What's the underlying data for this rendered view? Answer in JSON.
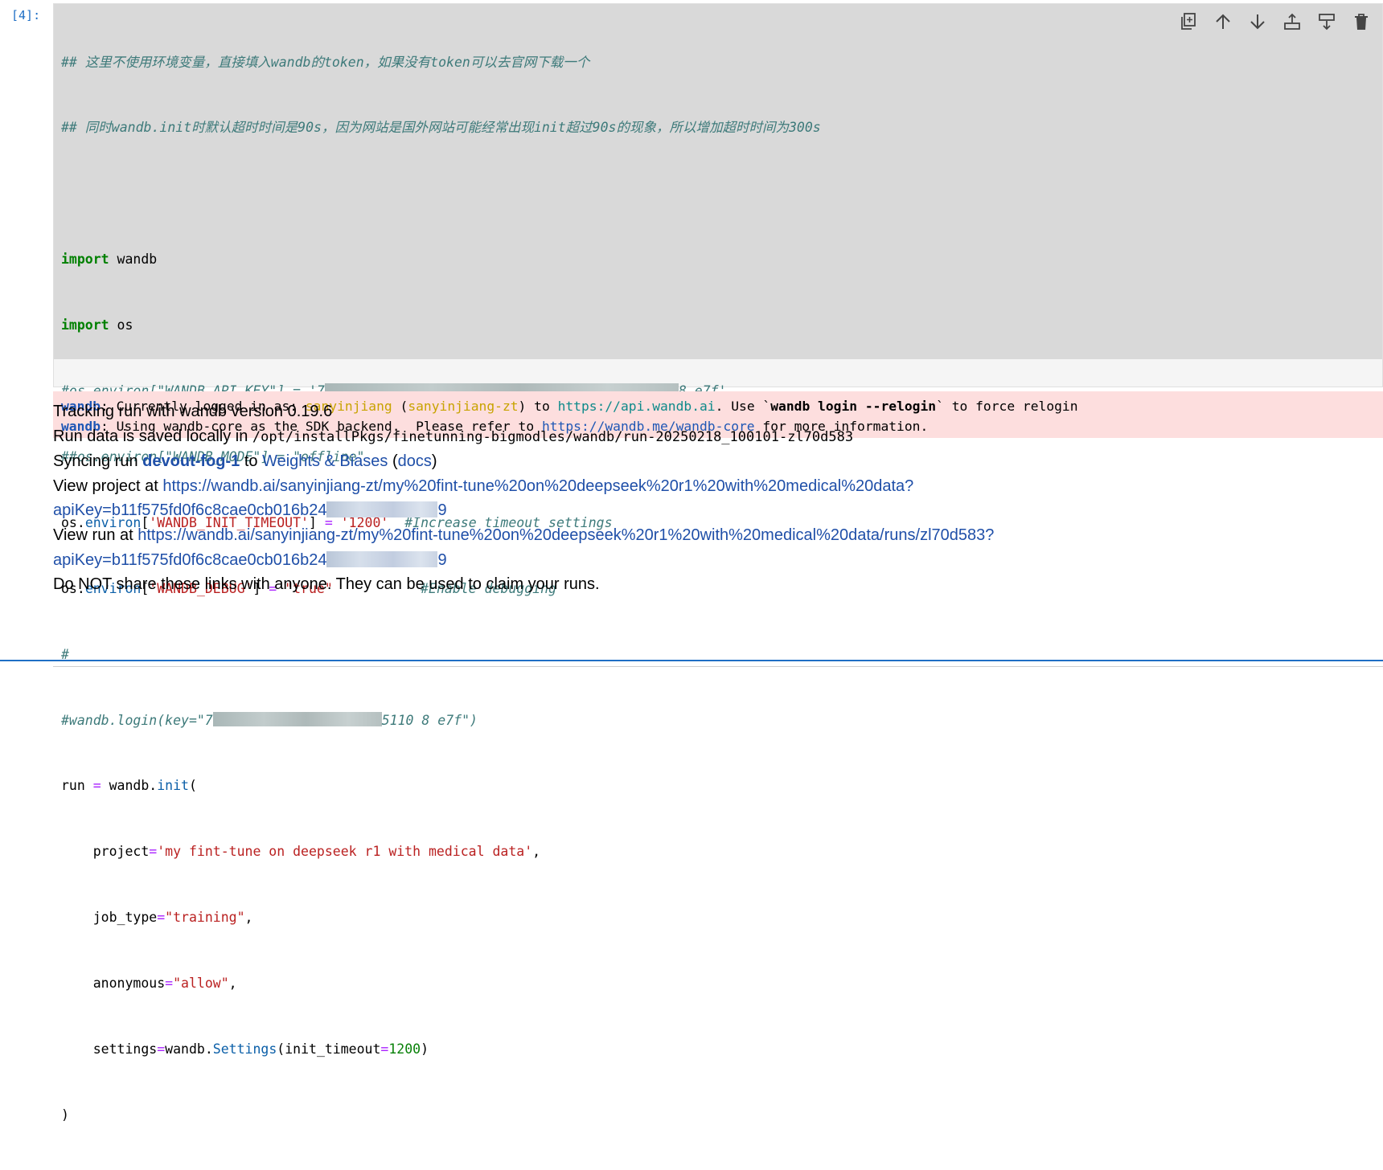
{
  "cell": {
    "prompt": "[4]:",
    "code": {
      "c1": "## 这里不使用环境变量，直接填入wandb的token，如果没有token可以去官网下载一个",
      "c2": "## 同时wandb.init时默认超时时间是90s，因为网站是国外网站可能经常出现init超过90s的现象，所以增加超时时间为300s",
      "import": "import",
      "wandb": "wandb",
      "os": "os",
      "api_key_prefix": "#os.environ[\"WANDB_API_KEY\"] = '7",
      "api_key_suffix": "8 e7f'",
      "mode_line": "##os.environ[\"WANDB_MODE\"] = \"offline\"",
      "os_obj": "os",
      "dot": ".",
      "environ": "environ",
      "lbr": "[",
      "rbr": "]",
      "init_timeout_key": "'WANDB_INIT_TIMEOUT'",
      "eq": " = ",
      "init_timeout_val": "'1200'",
      "timeout_comment": "#Increase timeout settings",
      "debug_key": "'WANDB_DEBUG'",
      "debug_val": "\"true\"",
      "debug_comment": "#Enable debugging",
      "hash": "#",
      "login_prefix": "#wandb.login(key=\"7",
      "login_suffix": "5110 8 e7f\")",
      "run": "run",
      "wandb2": "wandb",
      "init": "init",
      "paren_open": "(",
      "project_kw": "project",
      "project_val": "'my fint-tune on deepseek r1 with medical data'",
      "jobtype_kw": "job_type",
      "jobtype_val": "\"training\"",
      "anon_kw": "anonymous",
      "anon_val": "\"allow\"",
      "settings_kw": "settings",
      "wandb3": "wandb",
      "Settings": "Settings",
      "it_kw": "init_timeout",
      "it_val": "1200",
      "paren_close": ")",
      "comma": ",",
      "eq_tight": "=",
      "eq_spaced": " = "
    }
  },
  "toolbar": {
    "icons": [
      "duplicate-cell-icon",
      "move-up-icon",
      "move-down-icon",
      "insert-above-icon",
      "insert-below-icon",
      "delete-icon"
    ]
  },
  "stderr": {
    "prefix": "wandb",
    "line1_a": ": Currently logged in as: ",
    "user": "sanyinjiang",
    "lp": " (",
    "team": "sanyinjiang-zt",
    "rp": ") to ",
    "api_url": "https://api.wandb.ai",
    "line1_b": ". Use `",
    "cmd": "wandb login --relogin",
    "line1_c": "` to force relogin",
    "line2_a": ": Using wandb-core as the SDK backend.  Please refer to ",
    "core_url": "https://wandb.me/wandb-core",
    "line2_b": " for more information."
  },
  "output": {
    "version_line": "Tracking run with wandb version 0.19.6",
    "saved_label": "Run data is saved locally in ",
    "saved_path": "/opt/installPkgs/finetunning-bigmodles/wandb/run-20250218_100101-zl70d583",
    "sync_label": "Syncing run ",
    "run_name": "devout-fog-1",
    "sync_to": " to ",
    "wb_link": "Weights & Biases",
    "docs_open": " (",
    "docs_link": "docs",
    "docs_close": ")",
    "project_label": "View project at ",
    "project_url": "https://wandb.ai/sanyinjiang-zt/my%20fint-tune%20on%20deepseek%20r1%20with%20medical%20data?",
    "project_key": "apiKey=b11f575fd0f6c8cae0cb016b24",
    "project_key_tail": "9",
    "run_label": "View run at ",
    "run_url": "https://wandb.ai/sanyinjiang-zt/my%20fint-tune%20on%20deepseek%20r1%20with%20medical%20data/runs/zl70d583?",
    "run_key": "apiKey=b11f575fd0f6c8cae0cb016b24",
    "run_key_tail": "9",
    "warning": "Do NOT share these links with anyone. They can be used to claim your runs."
  }
}
